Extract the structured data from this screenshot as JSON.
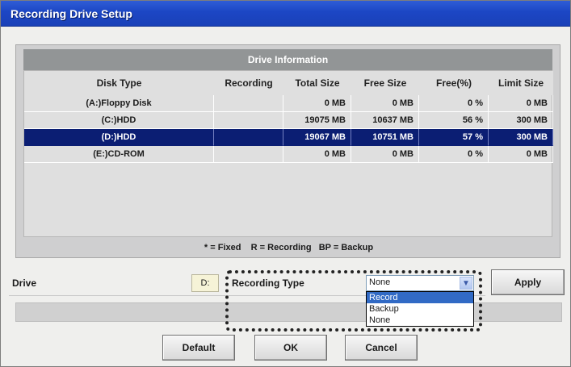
{
  "window": {
    "title": "Recording Drive Setup"
  },
  "drive_info": {
    "caption": "Drive Information",
    "columns": [
      "Disk Type",
      "Recording",
      "Total Size",
      "Free Size",
      "Free(%)",
      "Limit Size"
    ],
    "rows": [
      [
        "(A:)Floppy Disk",
        "",
        "0 MB",
        "0 MB",
        "0 %",
        "0 MB"
      ],
      [
        "(C:)HDD",
        "",
        "19075 MB",
        "10637 MB",
        "56 %",
        "300 MB"
      ],
      [
        "(D:)HDD",
        "",
        "19067 MB",
        "10751 MB",
        "57 %",
        "300 MB"
      ],
      [
        "(E:)CD-ROM",
        "",
        "0 MB",
        "0 MB",
        "0 %",
        "0 MB"
      ]
    ],
    "selected_row": 2,
    "legend": "* = Fixed    R = Recording   BP = Backup"
  },
  "drive": {
    "label": "Drive",
    "value": "D:"
  },
  "recording_type": {
    "label": "Recording Type",
    "selected": "None",
    "options": [
      "Record",
      "Backup",
      "None"
    ],
    "highlighted_option": "Record"
  },
  "buttons": {
    "apply": "Apply",
    "default": "Default",
    "ok": "OK",
    "cancel": "Cancel"
  },
  "colors": {
    "titlebar": "#1c46c4",
    "selected_row": "#0b1e73",
    "dropdown_highlight": "#316ac5"
  }
}
